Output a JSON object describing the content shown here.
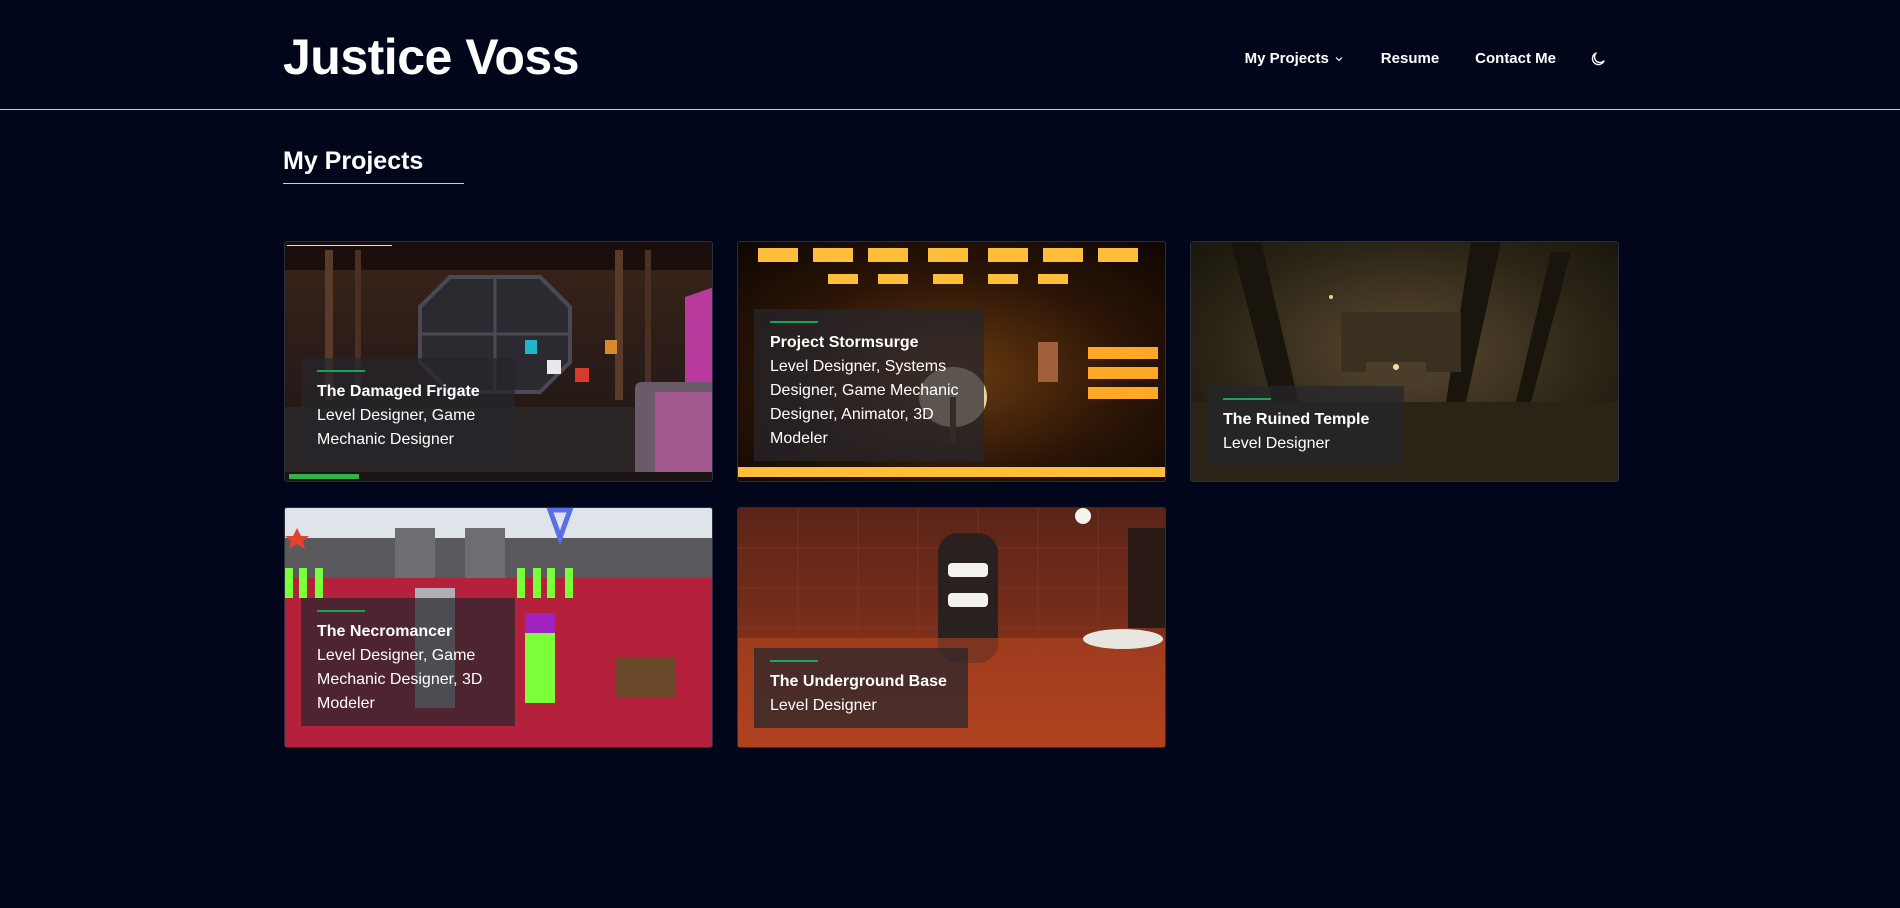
{
  "site": {
    "title": "Justice Voss"
  },
  "nav": {
    "projects_label": "My Projects",
    "resume_label": "Resume",
    "contact_label": "Contact Me"
  },
  "main": {
    "section_title": "My Projects",
    "projects": [
      {
        "title": "The Damaged Frigate",
        "roles": "Level Designer, Game Mechanic Designer"
      },
      {
        "title": "Project Stormsurge",
        "roles": "Level Designer, Systems Designer, Game Mechanic Designer, Animator, 3D Modeler"
      },
      {
        "title": "The Ruined Temple",
        "roles": "Level Designer"
      },
      {
        "title": "The Necromancer",
        "roles": "Level Designer, Game Mechanic Designer, 3D Modeler"
      },
      {
        "title": "The Underground Base",
        "roles": "Level Designer"
      }
    ]
  },
  "colors": {
    "background": "#02061a",
    "accent": "#19a35b",
    "divider": "#c9ccd6"
  },
  "icons": {
    "dropdown": "chevron-down-icon",
    "theme": "moon-icon"
  }
}
